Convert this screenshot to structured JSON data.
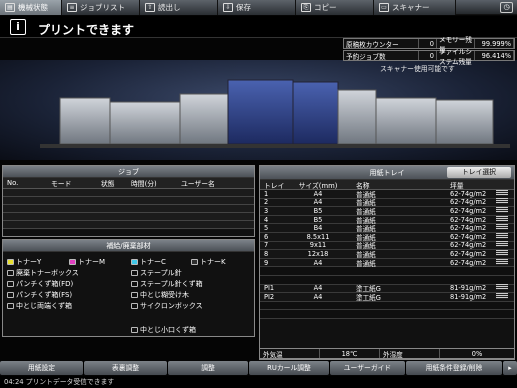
{
  "tabs": [
    {
      "label": "機械状態",
      "icon": "machine-status-icon",
      "active": true
    },
    {
      "label": "ジョブリスト",
      "icon": "job-list-icon",
      "active": false
    },
    {
      "label": "読出し",
      "icon": "recall-icon",
      "active": false
    },
    {
      "label": "保存",
      "icon": "save-icon",
      "active": false
    },
    {
      "label": "コピー",
      "icon": "copy-icon",
      "active": false
    },
    {
      "label": "スキャナー",
      "icon": "scanner-icon",
      "active": false
    }
  ],
  "message": "プリントできます",
  "counters": [
    {
      "label": "原稿枚カウンター",
      "count": "0",
      "meter": "メモリー残量",
      "value": "99.999%"
    },
    {
      "label": "予約ジョブ数",
      "count": "0",
      "meter": "ファイルシステム残量",
      "value": "96.414%"
    }
  ],
  "scanner_status": "スキャナー使用可能です",
  "job_panel": {
    "title": "ジョブ",
    "columns": [
      "No.",
      "モード",
      "状態",
      "時間(分)",
      "ユーザー名"
    ]
  },
  "supply_panel": {
    "title": "補給/廃棄部材",
    "items": [
      {
        "label": "トナーY",
        "color": "#e8e030"
      },
      {
        "label": "トナーM",
        "color": "#e040c0"
      },
      {
        "label": "トナーC",
        "color": "#40c8e8"
      },
      {
        "label": "トナーK",
        "color": "#303030"
      },
      {
        "label": "廃棄トナーボックス"
      },
      {
        "label": "ステープル針"
      },
      {
        "label": "パンチくず箱(FD)"
      },
      {
        "label": "ステープル針くず箱"
      },
      {
        "label": "パンチくず箱(FS)"
      },
      {
        "label": "中とじ糊受け木"
      },
      {
        "label": "中とじ両端くず箱"
      },
      {
        "label": "サイクロンボックス"
      },
      {
        "label": "中とじ小口くず箱"
      }
    ]
  },
  "tray_panel": {
    "title": "用紙トレイ",
    "select_button": "トレイ選択",
    "columns": [
      "トレイ",
      "サイズ(mm)",
      "名称",
      "坪量"
    ],
    "rows": [
      {
        "tray": "1",
        "size": "A4",
        "name": "普通紙",
        "weight": "62-74g/m2"
      },
      {
        "tray": "2",
        "size": "A4",
        "name": "普通紙",
        "weight": "62-74g/m2"
      },
      {
        "tray": "3",
        "size": "B5",
        "name": "普通紙",
        "weight": "62-74g/m2"
      },
      {
        "tray": "4",
        "size": "B5",
        "name": "普通紙",
        "weight": "62-74g/m2"
      },
      {
        "tray": "5",
        "size": "B4",
        "name": "普通紙",
        "weight": "62-74g/m2"
      },
      {
        "tray": "6",
        "size": "8.5x11",
        "name": "普通紙",
        "weight": "62-74g/m2"
      },
      {
        "tray": "7",
        "size": "9x11",
        "name": "普通紙",
        "weight": "62-74g/m2"
      },
      {
        "tray": "8",
        "size": "12x18",
        "name": "普通紙",
        "weight": "62-74g/m2"
      },
      {
        "tray": "9",
        "size": "A4",
        "name": "普通紙",
        "weight": "62-74g/m2"
      },
      {
        "tray": "",
        "size": "",
        "name": "",
        "weight": ""
      },
      {
        "tray": "",
        "size": "",
        "name": "",
        "weight": ""
      },
      {
        "tray": "PI1",
        "size": "A4",
        "name": "塗工紙G",
        "weight": "81-91g/m2"
      },
      {
        "tray": "PI2",
        "size": "A4",
        "name": "塗工紙G",
        "weight": "81-91g/m2"
      },
      {
        "tray": "",
        "size": "",
        "name": "",
        "weight": ""
      },
      {
        "tray": "",
        "size": "",
        "name": "",
        "weight": ""
      }
    ]
  },
  "environment": {
    "temp_label": "外気温",
    "temp_value": "18℃",
    "humidity_label": "外湿度",
    "humidity_value": "0%"
  },
  "buttons": [
    "用紙設定",
    "表裏調整",
    "調整",
    "RUカール調整",
    "ユーザーガイド",
    "用紙条件登録/削除"
  ],
  "status_line": "04:24  プリントデータ受信できます"
}
